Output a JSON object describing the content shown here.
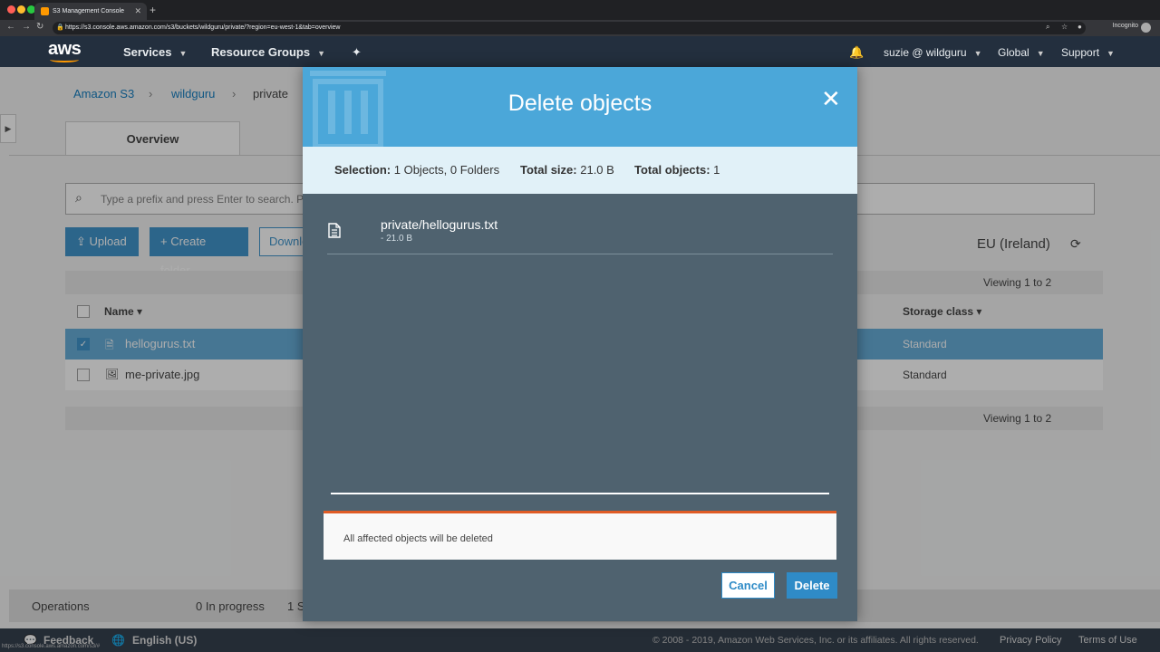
{
  "browser": {
    "tab_title": "S3 Management Console",
    "url": "https://s3.console.aws.amazon.com/s3/buckets/wildguru/private/?region=eu-west-1&tab=overview",
    "incognito_label": "Incognito",
    "status_url": "https://s3.console.aws.amazon.com/s3/#"
  },
  "header": {
    "logo": "aws",
    "services": "Services",
    "resource_groups": "Resource Groups",
    "user": "suzie @ wildguru",
    "region": "Global",
    "support": "Support"
  },
  "breadcrumb": {
    "root": "Amazon S3",
    "bucket": "wildguru",
    "folder": "private"
  },
  "tabs": {
    "overview": "Overview"
  },
  "search": {
    "placeholder": "Type a prefix and press Enter to search. P"
  },
  "toolbar": {
    "upload": "Upload",
    "create_folder": "Create folder",
    "download": "Download",
    "region": "EU (Ireland)"
  },
  "table": {
    "viewing": "Viewing 1 to 2",
    "col_name": "Name",
    "col_storage": "Storage class",
    "rows": [
      {
        "name": "hellogurus.txt",
        "storage": "Standard",
        "selected": true
      },
      {
        "name": "me-private.jpg",
        "storage": "Standard",
        "selected": false
      }
    ]
  },
  "operations": {
    "label": "Operations",
    "in_progress": "0 In progress",
    "success": "1 S"
  },
  "footer": {
    "feedback": "Feedback",
    "language": "English (US)",
    "copyright": "© 2008 - 2019, Amazon Web Services, Inc. or its affiliates. All rights reserved.",
    "privacy": "Privacy Policy",
    "terms": "Terms of Use"
  },
  "modal": {
    "title": "Delete objects",
    "selection_label": "Selection:",
    "selection_value": "1 Objects, 0 Folders",
    "size_label": "Total size:",
    "size_value": "21.0 B",
    "objects_label": "Total objects:",
    "objects_value": "1",
    "file_name": "private/hellogurus.txt",
    "file_size": "- 21.0 B",
    "warning": "All affected objects will be deleted",
    "cancel": "Cancel",
    "delete": "Delete"
  },
  "colors": {
    "aws_dark": "#232f3e",
    "aws_orange": "#ff9900",
    "modal_header": "#4ba7d9",
    "modal_body": "#4f626f",
    "primary_button": "#2f8bc7",
    "warning_accent": "#e05c25"
  }
}
